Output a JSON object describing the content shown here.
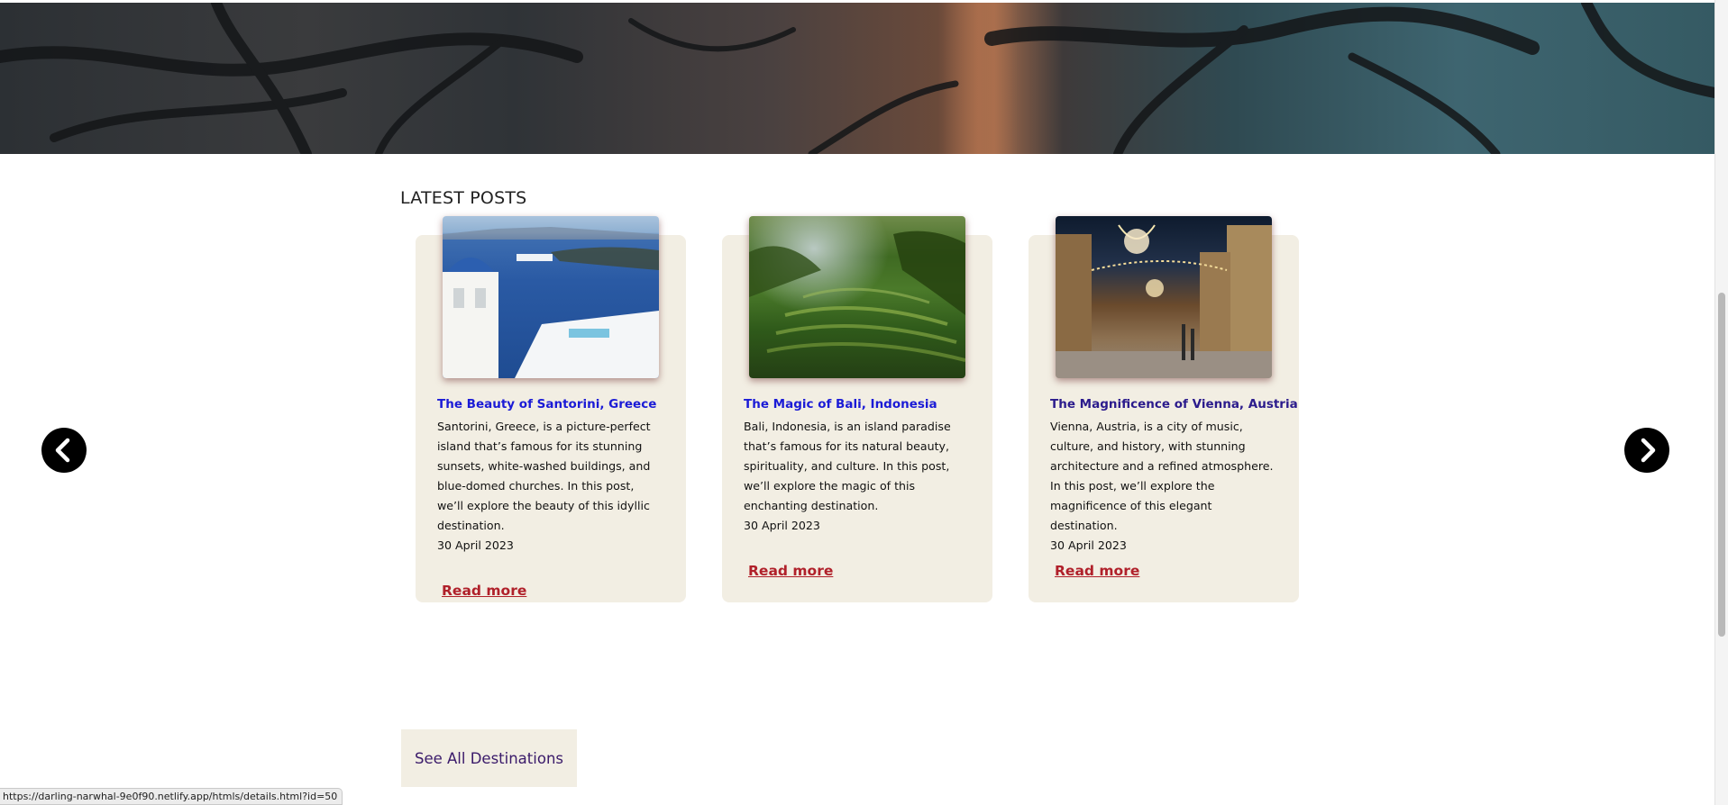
{
  "section": {
    "title": "LATEST POSTS"
  },
  "posts": [
    {
      "title": "The Beauty of Santorini, Greece",
      "description": "Santorini, Greece, is a picture-perfect island that’s famous for its stunning sunsets, white-washed buildings, and blue-domed churches. In this post, we’ll explore the beauty of this idyllic destination.",
      "date": "30 April 2023",
      "read_more": "Read more"
    },
    {
      "title": "The Magic of Bali, Indonesia",
      "description": "Bali, Indonesia, is an island paradise that’s famous for its natural beauty, spirituality, and culture. In this post, we’ll explore the magic of this enchanting destination.",
      "date": "30 April 2023",
      "read_more": "Read more"
    },
    {
      "title": "The Magnificence of Vienna, Austria",
      "description": "Vienna, Austria, is a city of music, culture, and history, with stunning architecture and a refined atmosphere. In this post, we’ll explore the magnificence of this elegant destination.",
      "date": "30 April 2023",
      "read_more": "Read more"
    }
  ],
  "carousel": {
    "prev_icon": "chevron-left-icon",
    "next_icon": "chevron-right-icon"
  },
  "see_all": {
    "label": "See All Destinations"
  },
  "status_bar": {
    "url": "https://darling-narwhal-9e0f90.netlify.app/htmls/details.html?id=50"
  },
  "colors": {
    "card_bg": "#f2eee3",
    "link_title": "#1b1bd6",
    "link_visited": "#2b1b8c",
    "read_more": "#b0202a"
  }
}
